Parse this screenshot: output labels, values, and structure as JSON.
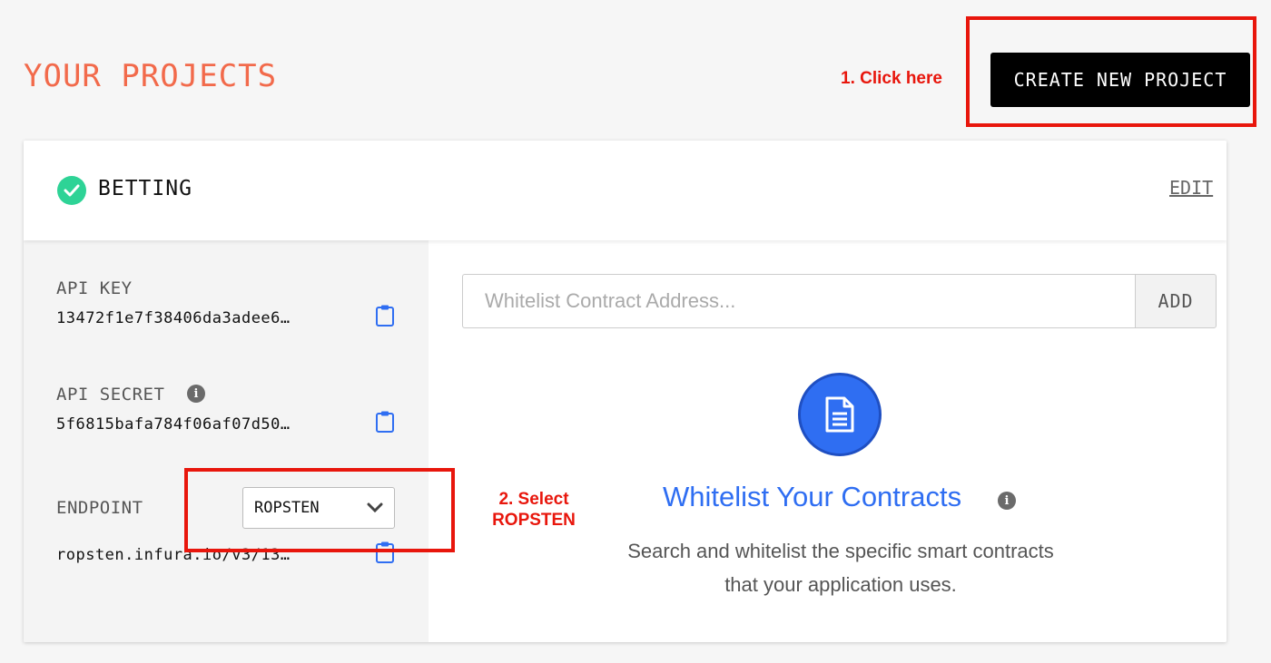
{
  "header": {
    "title": "YOUR PROJECTS",
    "create_button": "CREATE NEW PROJECT"
  },
  "annotations": {
    "step1": "1. Click here",
    "step2_line1": "2. Select",
    "step2_line2": "ROPSTEN",
    "highlight_color": "#e8160c"
  },
  "project": {
    "name": "BETTING",
    "status_icon": "check-circle-icon",
    "edit_label": "EDIT",
    "api_key_label": "API KEY",
    "api_key_value": "13472f1e7f38406da3adee6…",
    "api_secret_label": "API SECRET",
    "api_secret_value": "5f6815bafa784f06af07d50…",
    "endpoint_label": "ENDPOINT",
    "endpoint_selected": "ROPSTEN",
    "endpoint_value": "ropsten.infura.io/v3/13…"
  },
  "whitelist": {
    "input_placeholder": "Whitelist Contract Address...",
    "add_label": "ADD",
    "title": "Whitelist Your Contracts",
    "description": "Search and whitelist the specific smart contracts that your application uses."
  },
  "colors": {
    "accent_orange": "#f26a4b",
    "primary_blue": "#2f6ef2",
    "success_green": "#2ed396"
  }
}
